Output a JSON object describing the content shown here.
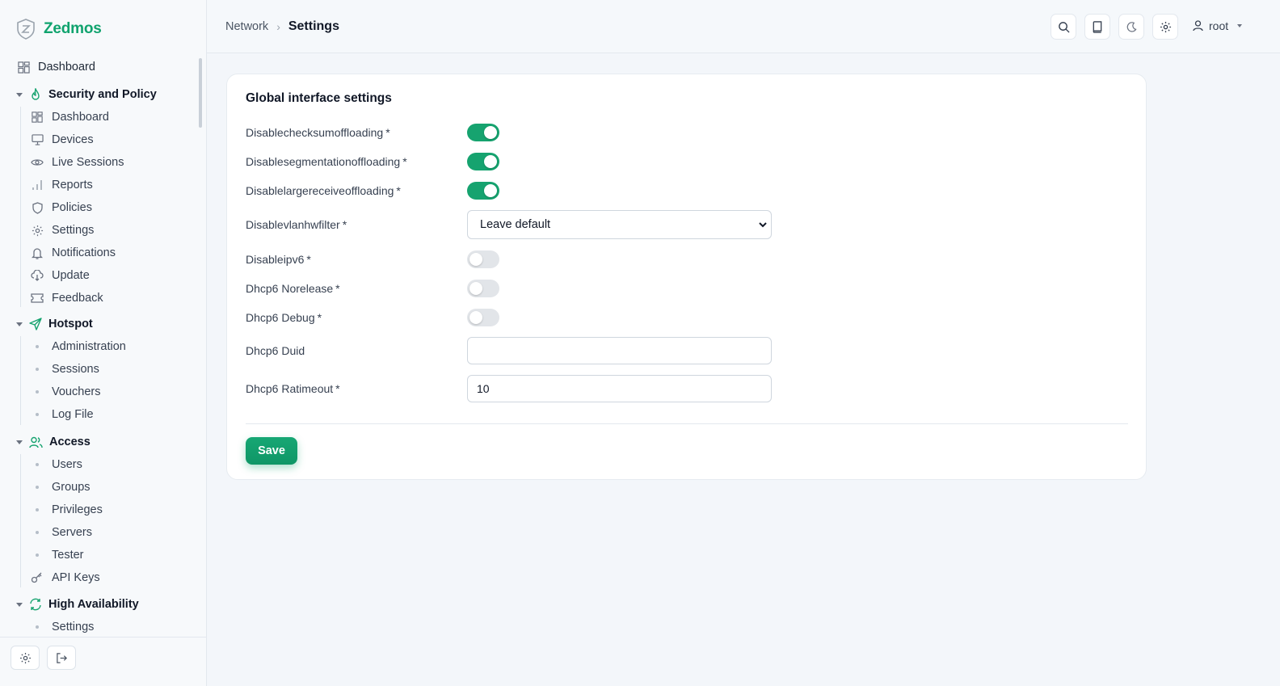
{
  "app": {
    "name": "Zedmos"
  },
  "sidebar": {
    "top_item": "Dashboard",
    "groups": [
      {
        "title": "Security and Policy",
        "icon": "flame-icon",
        "items": [
          {
            "label": "Dashboard",
            "icon": "dashboard-icon"
          },
          {
            "label": "Devices",
            "icon": "monitor-icon"
          },
          {
            "label": "Live Sessions",
            "icon": "eye-icon"
          },
          {
            "label": "Reports",
            "icon": "bar-chart-icon"
          },
          {
            "label": "Policies",
            "icon": "shield-icon"
          },
          {
            "label": "Settings",
            "icon": "gear-icon"
          },
          {
            "label": "Notifications",
            "icon": "bell-icon"
          },
          {
            "label": "Update",
            "icon": "cloud-download-icon"
          },
          {
            "label": "Feedback",
            "icon": "ticket-icon"
          }
        ]
      },
      {
        "title": "Hotspot",
        "icon": "send-icon",
        "items": [
          {
            "label": "Administration"
          },
          {
            "label": "Sessions"
          },
          {
            "label": "Vouchers"
          },
          {
            "label": "Log File"
          }
        ]
      },
      {
        "title": "Access",
        "icon": "users-icon",
        "items": [
          {
            "label": "Users"
          },
          {
            "label": "Groups"
          },
          {
            "label": "Privileges"
          },
          {
            "label": "Servers"
          },
          {
            "label": "Tester"
          },
          {
            "label": "API Keys",
            "icon": "key-icon"
          }
        ]
      },
      {
        "title": "High Availability",
        "icon": "refresh-icon",
        "items": [
          {
            "label": "Settings"
          }
        ]
      }
    ]
  },
  "header": {
    "breadcrumb": [
      "Network",
      "Settings"
    ],
    "user": "root"
  },
  "form": {
    "title": "Global interface settings",
    "toggles": [
      {
        "label": "Disablechecksumoffloading",
        "required": "*",
        "on": true
      },
      {
        "label": "Disablesegmentationoffloading",
        "required": "*",
        "on": true
      },
      {
        "label": "Disablelargereceiveoffloading",
        "required": "*",
        "on": true
      }
    ],
    "vlan": {
      "label": "Disablevlanhwfilter",
      "required": "*",
      "selected": "Leave default"
    },
    "toggles2": [
      {
        "label": "Disableipv6",
        "required": "*",
        "on": false
      },
      {
        "label": "Dhcp6 Norelease",
        "required": "*",
        "on": false
      },
      {
        "label": "Dhcp6 Debug",
        "required": "*",
        "on": false
      }
    ],
    "duid": {
      "label": "Dhcp6 Duid",
      "value": ""
    },
    "ratimeout": {
      "label": "Dhcp6 Ratimeout",
      "required": "*",
      "value": "10"
    },
    "save_label": "Save"
  },
  "colors": {
    "accent": "#16a36f",
    "brand": "#10a36e"
  }
}
